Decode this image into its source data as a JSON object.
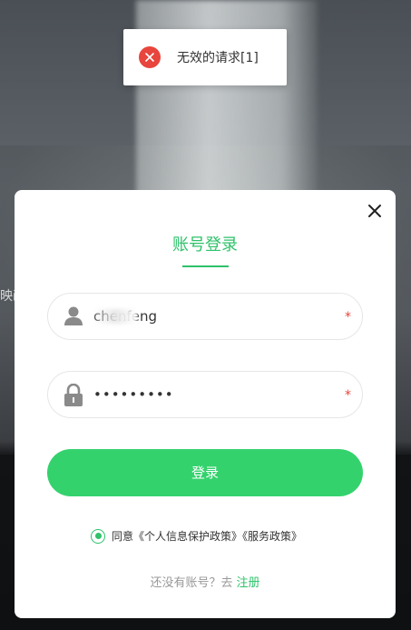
{
  "toast": {
    "message": "无效的请求[1]",
    "icon": "error-close-icon",
    "color": "#e8453c"
  },
  "background": {
    "side_text": "映画"
  },
  "login": {
    "title": "账号登录",
    "username_value": "chenfeng",
    "username_icon": "user-icon",
    "password_value": "•••••••••",
    "password_icon": "lock-icon",
    "required_mark": "*",
    "submit_label": "登录",
    "agree_text": "同意《个人信息保护政策》《服务政策》",
    "register_prompt": "还没有账号？去",
    "register_link": "注册",
    "accent_color": "#2fc26b",
    "button_color": "#34d26d"
  }
}
